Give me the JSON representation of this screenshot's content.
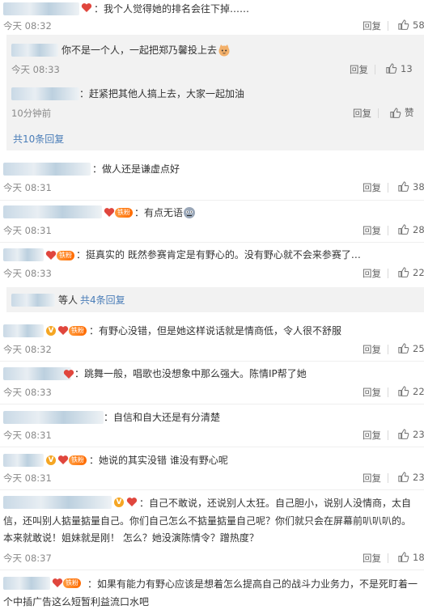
{
  "comments": [
    {
      "text": "：我个人觉得她的排名会往下掉……",
      "time": "今天 08:32",
      "reply": "回复",
      "likes": "58"
    },
    {
      "text": "：做人还是谦虚点好",
      "time": "今天 08:31",
      "reply": "回复",
      "likes": "38"
    },
    {
      "text": "：有点无语",
      "time": "今天 08:31",
      "reply": "回复",
      "likes": "28"
    },
    {
      "text": "：挺真实的 既然参赛肯定是有野心的。没有野心就不会来参赛了…",
      "time": "今天 08:33",
      "reply": "回复",
      "likes": "22"
    },
    {
      "text": "：有野心没错，但是她这样说话就是情商低，令人很不舒服",
      "time": "今天 08:32",
      "reply": "回复",
      "likes": "25"
    },
    {
      "text": "：跳舞一般，唱歌也没想象中那么强大。陈情IP帮了她",
      "time": "今天 08:33",
      "reply": "回复",
      "likes": "22"
    },
    {
      "text": "：自信和自大还是有分清楚",
      "time": "今天 08:31",
      "reply": "回复",
      "likes": "23"
    },
    {
      "text": "：她说的其实没错 谁没有野心呢",
      "time": "今天 08:31",
      "reply": "回复",
      "likes": "23"
    },
    {
      "text": "：自己不敢说，还说别人太狂。自己胆小，说别人没情商，太自信，还叫别人掂量掂量自己。你们自己怎么不掂量掂量自己呢？你们就只会在屏幕前叭叭叭的。本来就敢说！姐妹就是刚！ 怎么？她没演陈情令？蹭热度？",
      "time": "今天 08:37",
      "reply": "回复",
      "likes": "18"
    },
    {
      "text": "：如果有能力有野心应该是想着怎么提高自己的战斗力业务力，不是死盯着一个中插广告这么短暂利益流口水吧"
    }
  ],
  "replies": [
    {
      "text": "你不是一个人，一起把郑乃馨投上去",
      "time": "今天 08:33",
      "reply": "回复",
      "likes": "13"
    },
    {
      "text": "：赶紧把其他人搞上去，大家一起加油",
      "time": "10分钟前",
      "reply": "回复",
      "likes": "赞"
    }
  ],
  "more_replies_1": "共10条回复",
  "more_replies_2_prefix": "等人",
  "more_replies_2": "共4条回复",
  "badges": {
    "fan": "铁粉",
    "verified": "V"
  },
  "colors": {
    "link": "#4a7db8",
    "fan_badge": "#ff7a1a",
    "verified": "#f5a623",
    "sub_background": "#f2f2f2"
  }
}
